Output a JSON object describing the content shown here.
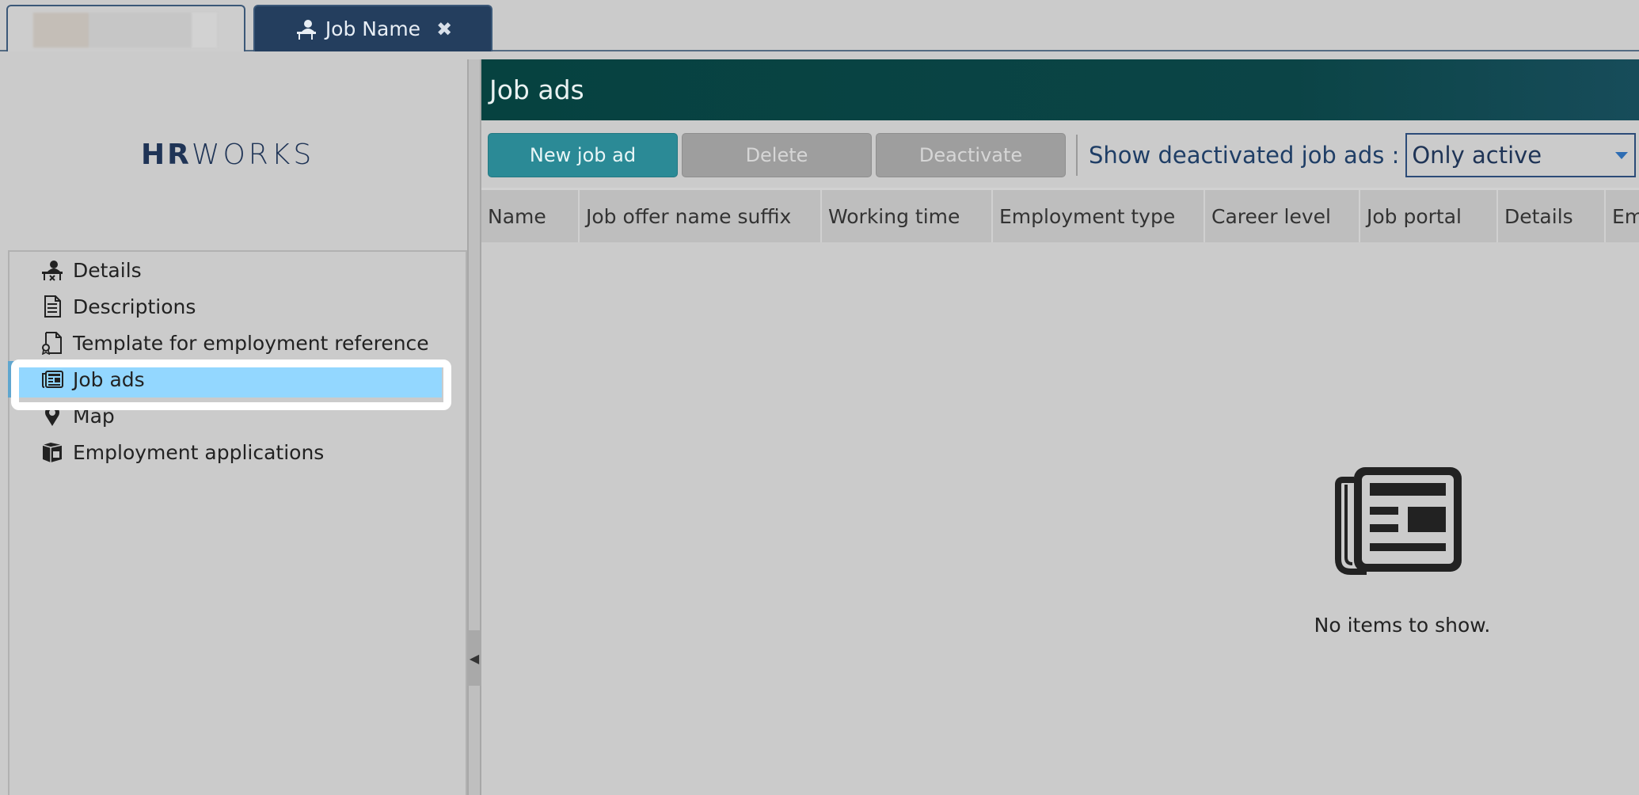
{
  "tabs": [
    {
      "label": ""
    },
    {
      "label": "Job Name",
      "icon": "person-desk-icon",
      "close_label": "✖"
    }
  ],
  "sidebar": {
    "logo": {
      "bold": "HR",
      "light": "WORKS"
    },
    "items": [
      {
        "label": "Details",
        "icon": "person-desk-icon"
      },
      {
        "label": "Descriptions",
        "icon": "document-icon"
      },
      {
        "label": "Template for employment reference",
        "icon": "certificate-icon"
      },
      {
        "label": "Job ads",
        "icon": "newspaper-icon",
        "selected": true
      },
      {
        "label": "Map",
        "icon": "map-pin-icon"
      },
      {
        "label": "Employment applications",
        "icon": "box-icon"
      }
    ]
  },
  "main": {
    "title": "Job ads",
    "toolbar": {
      "new_label": "New job ad",
      "delete_label": "Delete",
      "deactivate_label": "Deactivate",
      "filter_label": "Show deactivated job ads :",
      "filter_value": "Only active"
    },
    "columns": [
      "Name",
      "Job offer name suffix",
      "Working time",
      "Employment type",
      "Career level",
      "Job portal",
      "Details",
      "Em"
    ],
    "empty_text": "No items to show."
  },
  "colors": {
    "header_teal": "#064240",
    "primary_button": "#2b8a96",
    "selected_item": "#93d7ff",
    "tab_active": "#243e5e"
  }
}
